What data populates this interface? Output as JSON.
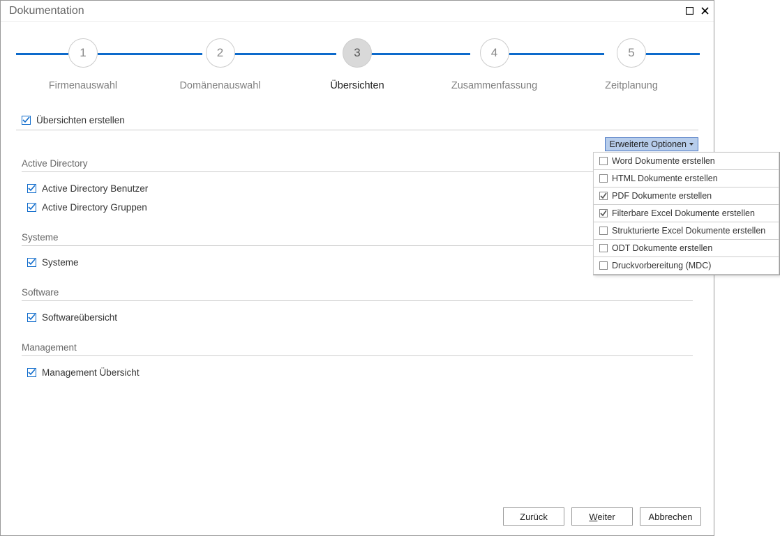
{
  "window": {
    "title": "Dokumentation"
  },
  "stepper": {
    "steps": [
      {
        "num": "1",
        "label": "Firmenauswahl"
      },
      {
        "num": "2",
        "label": "Domänenauswahl"
      },
      {
        "num": "3",
        "label": "Übersichten"
      },
      {
        "num": "4",
        "label": "Zusammenfassung"
      },
      {
        "num": "5",
        "label": "Zeitplanung"
      }
    ],
    "active_index": 2
  },
  "overview_checkbox": {
    "label": "Übersichten erstellen",
    "checked": true
  },
  "advanced": {
    "button_label": "Erweiterte Optionen",
    "items": [
      {
        "label": "Word Dokumente erstellen",
        "checked": false
      },
      {
        "label": "HTML Dokumente erstellen",
        "checked": false
      },
      {
        "label": "PDF Dokumente  erstellen",
        "checked": true
      },
      {
        "label": "Filterbare Excel Dokumente erstellen",
        "checked": true
      },
      {
        "label": "Strukturierte Excel Dokumente erstellen",
        "checked": false
      },
      {
        "label": "ODT Dokumente  erstellen",
        "checked": false
      },
      {
        "label": "Druckvorbereitung (MDC)",
        "checked": false
      }
    ]
  },
  "sections": [
    {
      "title": "Active Directory",
      "items": [
        {
          "label": "Active Directory Benutzer",
          "checked": true
        },
        {
          "label": "Active Directory Gruppen",
          "checked": true
        }
      ]
    },
    {
      "title": "Systeme",
      "items": [
        {
          "label": "Systeme",
          "checked": true
        }
      ]
    },
    {
      "title": "Software",
      "items": [
        {
          "label": "Softwareübersicht",
          "checked": true
        }
      ]
    },
    {
      "title": "Management",
      "items": [
        {
          "label": "Management Übersicht",
          "checked": true
        }
      ]
    }
  ],
  "footer": {
    "back": "Zurück",
    "next_prefix": "W",
    "next_rest": "eiter",
    "cancel": "Abbrechen"
  }
}
